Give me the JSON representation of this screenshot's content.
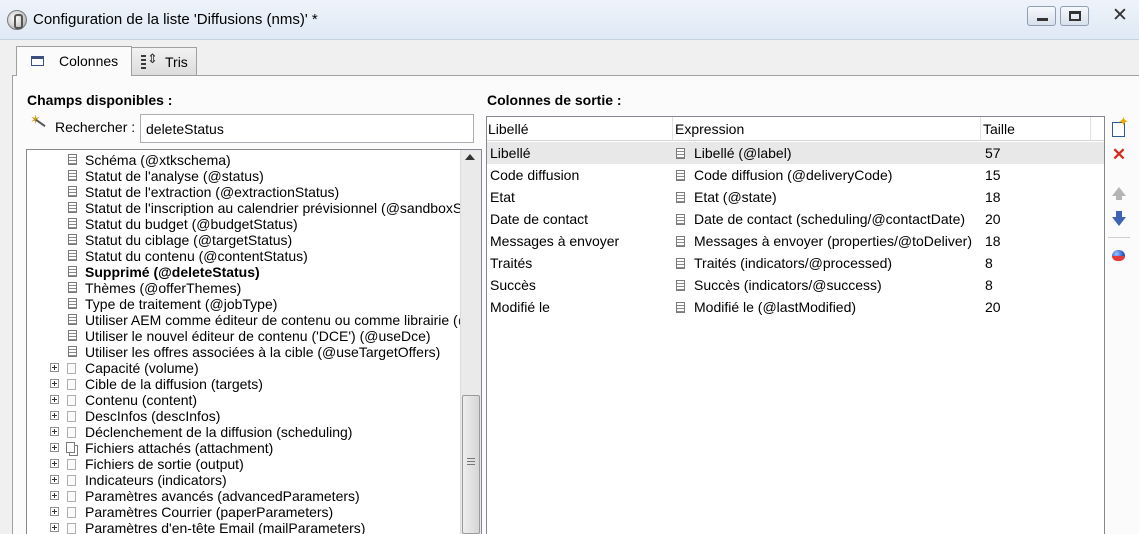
{
  "window": {
    "title": "Configuration de la liste 'Diffusions (nms)' *",
    "close_glyph": "✕"
  },
  "tabs": [
    {
      "label": "Colonnes",
      "icon": "columns-icon",
      "active": true
    },
    {
      "label": "Tris",
      "icon": "sort-icon",
      "active": false
    }
  ],
  "available_fields": {
    "heading": "Champs disponibles :",
    "search_label": "Rechercher :",
    "search_value": "deleteStatus",
    "tree": [
      {
        "label": "Schéma (@xtkschema)",
        "kind": "attr"
      },
      {
        "label": "Statut de l'analyse (@status)",
        "kind": "attr"
      },
      {
        "label": "Statut de l'extraction (@extractionStatus)",
        "kind": "attr"
      },
      {
        "label": "Statut de l'inscription au calendrier prévisionnel (@sandboxStatus)",
        "kind": "attr"
      },
      {
        "label": "Statut du budget (@budgetStatus)",
        "kind": "attr"
      },
      {
        "label": "Statut du ciblage (@targetStatus)",
        "kind": "attr"
      },
      {
        "label": "Statut du contenu (@contentStatus)",
        "kind": "attr"
      },
      {
        "label": "Supprimé (@deleteStatus)",
        "kind": "attr",
        "highlight": true
      },
      {
        "label": "Thèmes (@offerThemes)",
        "kind": "attr"
      },
      {
        "label": "Type de traitement (@jobType)",
        "kind": "attr"
      },
      {
        "label": "Utiliser AEM comme éditeur de contenu ou comme librairie (@useAEM)",
        "kind": "attr"
      },
      {
        "label": "Utiliser le nouvel éditeur de contenu ('DCE') (@useDce)",
        "kind": "attr"
      },
      {
        "label": "Utiliser les offres associées à la cible (@useTargetOffers)",
        "kind": "attr"
      },
      {
        "label": "Capacité (volume)",
        "kind": "elem"
      },
      {
        "label": "Cible de la diffusion (targets)",
        "kind": "elem"
      },
      {
        "label": "Contenu (content)",
        "kind": "elem"
      },
      {
        "label": "DescInfos (descInfos)",
        "kind": "elem"
      },
      {
        "label": "Déclenchement de la diffusion (scheduling)",
        "kind": "elem"
      },
      {
        "label": "Fichiers attachés (attachment)",
        "kind": "multi"
      },
      {
        "label": "Fichiers de sortie (output)",
        "kind": "elem"
      },
      {
        "label": "Indicateurs (indicators)",
        "kind": "elem"
      },
      {
        "label": "Paramètres avancés (advancedParameters)",
        "kind": "elem"
      },
      {
        "label": "Paramètres Courrier (paperParameters)",
        "kind": "elem"
      },
      {
        "label": "Paramètres d'en-tête Email (mailParameters)",
        "kind": "elem"
      }
    ]
  },
  "output_columns": {
    "heading": "Colonnes de sortie :",
    "columns": [
      "Libellé",
      "Expression",
      "Taille"
    ],
    "rows": [
      {
        "label": "Libellé",
        "expression": "Libellé (@label)",
        "size": "57",
        "selected": true
      },
      {
        "label": "Code diffusion",
        "expression": "Code diffusion (@deliveryCode)",
        "size": "15"
      },
      {
        "label": "Etat",
        "expression": "Etat (@state)",
        "size": "18"
      },
      {
        "label": "Date de contact",
        "expression": "Date de contact (scheduling/@contactDate)",
        "size": "20"
      },
      {
        "label": "Messages à envoyer",
        "expression": "Messages à envoyer (properties/@toDeliver)",
        "size": "18"
      },
      {
        "label": "Traités",
        "expression": "Traités (indicators/@processed)",
        "size": "8"
      },
      {
        "label": "Succès",
        "expression": "Succès (indicators/@success)",
        "size": "8"
      },
      {
        "label": "Modifié le",
        "expression": "Modifié le (@lastModified)",
        "size": "20"
      }
    ]
  },
  "toolbar_icons": [
    "add-icon",
    "delete-icon",
    "move-up-icon",
    "move-down-icon",
    "formula-icon"
  ]
}
